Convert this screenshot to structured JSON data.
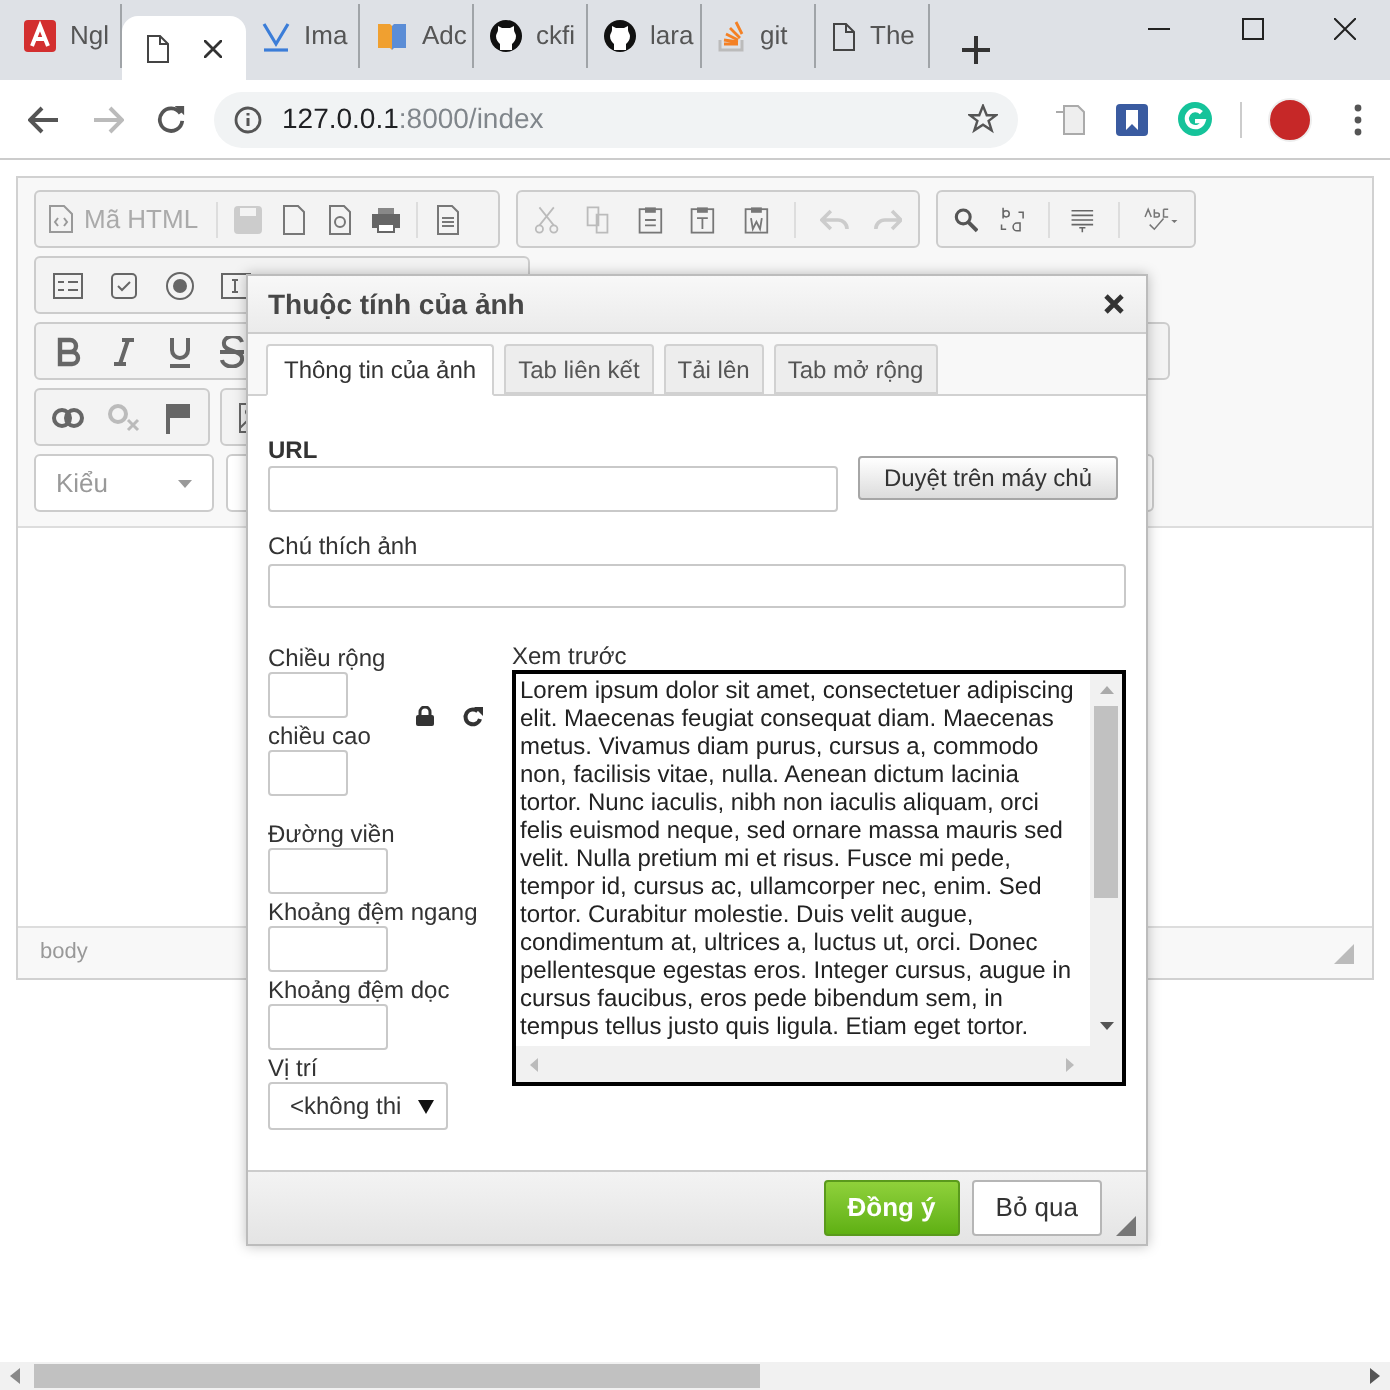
{
  "browser": {
    "tabs": [
      {
        "kind": "a-logo",
        "label": "Ngl",
        "selected": false
      },
      {
        "kind": "page",
        "selected": true
      },
      {
        "kind": "v-logo",
        "label": "Ima",
        "selected": false
      },
      {
        "kind": "book",
        "label": "Adc",
        "selected": false
      },
      {
        "kind": "github",
        "label": "ckfi",
        "selected": false
      },
      {
        "kind": "github",
        "label": "lara",
        "selected": false
      },
      {
        "kind": "stack",
        "label": "git",
        "selected": false
      },
      {
        "kind": "page",
        "label": "The",
        "selected": false
      }
    ],
    "address": {
      "host": "127.0.0.1",
      "path": ":8000/index"
    }
  },
  "editor": {
    "source_button": "Mã HTML",
    "styles_dropdown": "Kiểu",
    "path": "body"
  },
  "dialog": {
    "title": "Thuộc tính của ảnh",
    "tabs": [
      {
        "label": "Thông tin của ảnh",
        "selected": true
      },
      {
        "label": "Tab liên kết",
        "selected": false
      },
      {
        "label": "Tải lên",
        "selected": false
      },
      {
        "label": "Tab mở rộng",
        "selected": false
      }
    ],
    "url_label": "URL",
    "browse_button": "Duyệt trên máy chủ",
    "caption_label": "Chú thích ảnh",
    "fields": [
      {
        "kind": "size",
        "label": "Chiều rộng"
      },
      {
        "kind": "size",
        "label": "chiều cao"
      },
      {
        "kind": "spacing",
        "label": "Đường viền"
      },
      {
        "kind": "spacing",
        "label": "Khoảng đệm ngang"
      },
      {
        "kind": "spacing",
        "label": "Khoảng đệm dọc"
      },
      {
        "kind": "select",
        "label": "Vị trí",
        "value": "<không thi"
      }
    ],
    "preview_label": "Xem trước",
    "preview_text": "Lorem ipsum dolor sit amet, consectetuer adipiscing elit. Maecenas feugiat consequat diam. Maecenas metus. Vivamus diam purus, cursus a, commodo non, facilisis vitae, nulla. Aenean dictum lacinia tortor. Nunc iaculis, nibh non iaculis aliquam, orci felis euismod neque, sed ornare massa mauris sed velit. Nulla pretium mi et risus. Fusce mi pede, tempor id, cursus ac, ullamcorper nec, enim. Sed tortor. Curabitur molestie. Duis velit augue, condimentum at, ultrices a, luctus ut, orci. Donec pellentesque egestas eros. Integer cursus, augue in cursus faucibus, eros pede bibendum sem, in tempus tellus justo quis ligula. Etiam eget tortor.",
    "buttons": [
      {
        "kind": "primary",
        "label": "Đồng ý"
      },
      {
        "kind": "secondary",
        "label": "Bỏ qua"
      }
    ]
  }
}
